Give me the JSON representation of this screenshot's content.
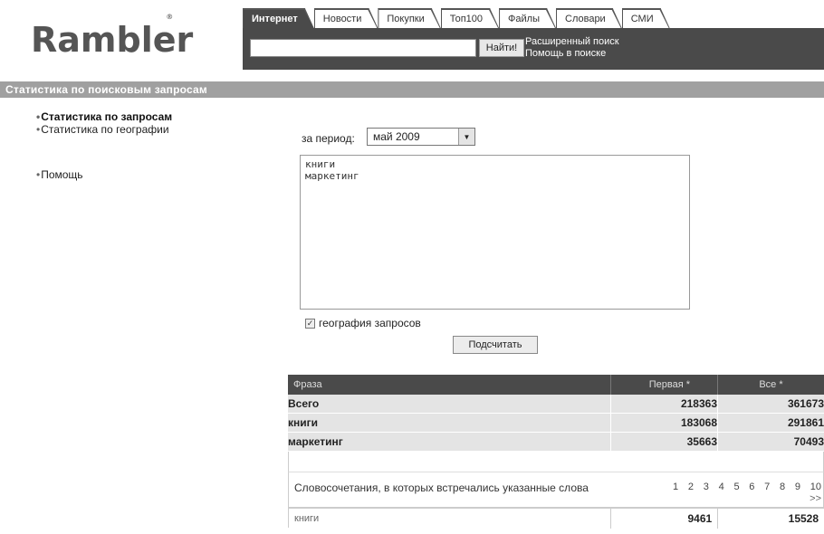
{
  "logo": {
    "text": "Rambler",
    "mark": "®"
  },
  "tabs": [
    {
      "label": "Интернет",
      "active": true
    },
    {
      "label": "Новости",
      "active": false
    },
    {
      "label": "Покупки",
      "active": false
    },
    {
      "label": "Топ100",
      "active": false
    },
    {
      "label": "Файлы",
      "active": false
    },
    {
      "label": "Словари",
      "active": false
    },
    {
      "label": "СМИ",
      "active": false
    }
  ],
  "search": {
    "value": "",
    "button_label": "Найти!",
    "advanced_link": "Расширенный поиск",
    "help_link": "Помощь в поиске"
  },
  "section": {
    "title": "Статистика по поисковым запросам"
  },
  "leftnav": {
    "bullet": "•",
    "items": [
      "Статистика по запросам",
      "Статистика по географии"
    ],
    "help": "Помощь"
  },
  "form": {
    "period_label": "за период:",
    "period_value": "май 2009",
    "queries": "книги\nмаркетинг",
    "geo_label": "география запросов",
    "geo_checked": true,
    "calc_label": "Подсчитать"
  },
  "results": {
    "headers": {
      "phrase": "Фраза",
      "first": "Первая *",
      "all": "Все *"
    },
    "rows": [
      {
        "phrase": "Всего",
        "first": "218363",
        "all": "361673"
      },
      {
        "phrase": "книги",
        "first": "183068",
        "all": "291861"
      },
      {
        "phrase": "маркетинг",
        "first": "35663",
        "all": "70493"
      }
    ],
    "combo_text": "Словосочетания, в которых встречались указанные слова",
    "pages": [
      "1",
      "2",
      "3",
      "4",
      "5",
      "6",
      "7",
      "8",
      "9",
      "10"
    ],
    "next": ">>",
    "last_row": {
      "phrase": "книги",
      "first": "9461",
      "all": "15528"
    }
  }
}
